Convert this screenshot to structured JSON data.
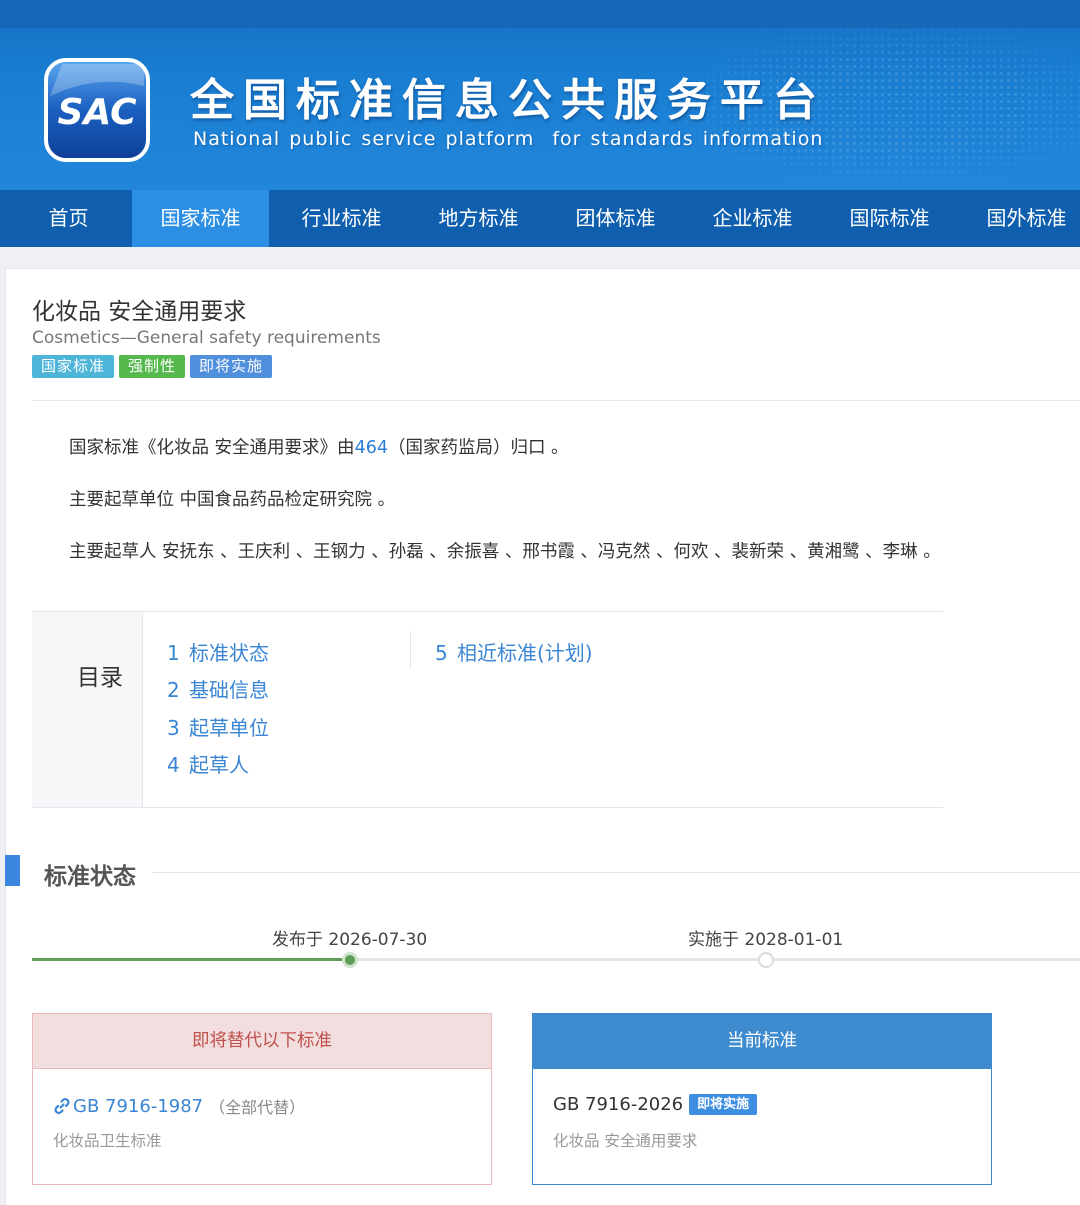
{
  "header": {
    "logo_text": "SAC",
    "title_cn": "全国标准信息公共服务平台",
    "title_en": "National public service platform  for standards information"
  },
  "nav": {
    "items": [
      "首页",
      "国家标准",
      "行业标准",
      "地方标准",
      "团体标准",
      "企业标准",
      "国际标准",
      "国外标准"
    ],
    "active": "国家标准"
  },
  "standard": {
    "title": "化妆品 安全通用要求",
    "title_en": "Cosmetics—General safety requirements",
    "tags": [
      "国家标准",
      "强制性",
      "即将实施"
    ]
  },
  "info": {
    "line1_prefix": "国家标准《化妆品 安全通用要求》由",
    "line1_link": "464",
    "line1_suffix": "（国家药监局）归口 。",
    "line2": "主要起草单位 中国食品药品检定研究院 。",
    "line3": "主要起草人 安抚东 、王庆利 、王钢力 、孙磊 、余振喜 、邢书霞 、冯克然 、何欢 、裴新荣 、黄湘鹭 、李琳 。"
  },
  "toc": {
    "label": "目录",
    "items": [
      {
        "num": "1",
        "label": "标准状态"
      },
      {
        "num": "2",
        "label": "基础信息"
      },
      {
        "num": "3",
        "label": "起草单位"
      },
      {
        "num": "4",
        "label": "起草人"
      },
      {
        "num": "5",
        "label": "相近标准(计划)"
      }
    ]
  },
  "status_section": {
    "title": "标准状态",
    "published": "发布于 2026-07-30",
    "implemented": "实施于 2028-01-01",
    "colors": {
      "done": "#5e9e59",
      "pending": "#d9dbde"
    }
  },
  "replace_box": {
    "header": "即将替代以下标准",
    "code": "GB 7916-1987",
    "note": "（全部代替）",
    "name": "化妆品卫生标准"
  },
  "current_box": {
    "header": "当前标准",
    "code": "GB 7916-2026",
    "badge": "即将实施",
    "name": "化妆品 安全通用要求"
  }
}
